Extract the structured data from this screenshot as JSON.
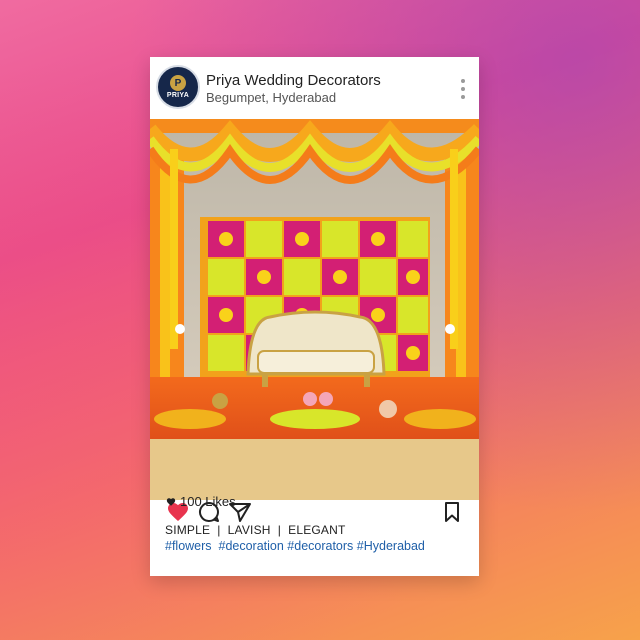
{
  "post": {
    "author": "Priya Wedding Decorators",
    "location": "Begumpet, Hyderabad",
    "avatar_text": "PRIYA",
    "avatar_letter": "P",
    "likes_label": "100 Likes",
    "caption": "SIMPLE  |  LAVISH  |  ELEGANT",
    "hashtags": "#flowers  #decoration #decorators #Hyderabad",
    "liked": true
  },
  "icons": {
    "heart": "heart-icon",
    "comment": "comment-icon",
    "share": "share-icon",
    "bookmark": "bookmark-icon",
    "more": "more-options-icon"
  },
  "colors": {
    "heart": "#e8344e",
    "hashtag": "#1f5fa8",
    "avatar_bg": "#16274a",
    "avatar_gold": "#c9a243"
  }
}
